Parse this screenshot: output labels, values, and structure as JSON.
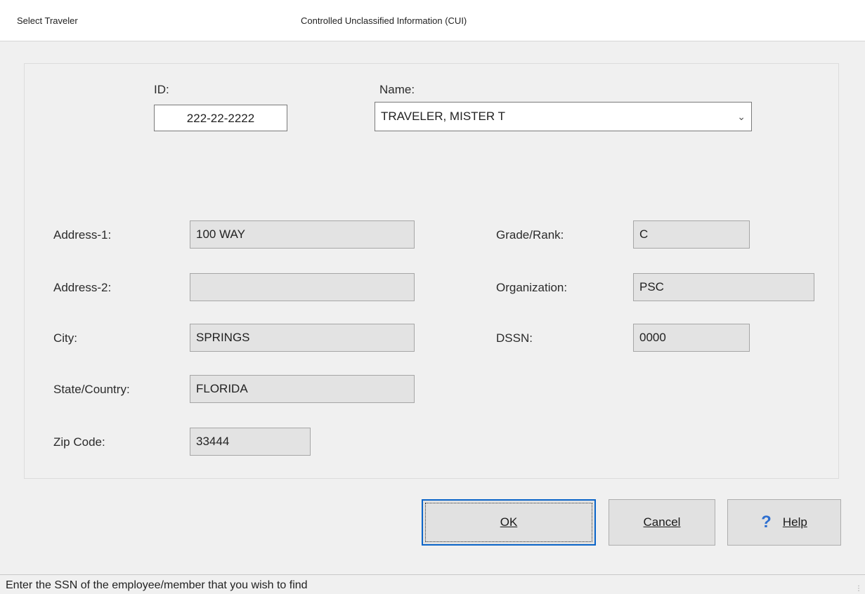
{
  "window": {
    "title_left": "Select Traveler",
    "title_center": "Controlled Unclassified Information (CUI)"
  },
  "form": {
    "id_label": "ID:",
    "id_value": "222-22-2222",
    "name_label": "Name:",
    "name_value": "TRAVELER, MISTER T",
    "address1_label": "Address-1:",
    "address1_value": "100 WAY",
    "address2_label": "Address-2:",
    "address2_value": "",
    "city_label": "City:",
    "city_value": "SPRINGS",
    "state_label": "State/Country:",
    "state_value": "FLORIDA",
    "zip_label": "Zip Code:",
    "zip_value": "33444",
    "grade_label": "Grade/Rank:",
    "grade_value": "C",
    "org_label": "Organization:",
    "org_value": "PSC",
    "dssn_label": "DSSN:",
    "dssn_value": "0000"
  },
  "buttons": {
    "ok_label": "OK",
    "cancel_label": "Cancel",
    "help_label": "Help",
    "help_icon": "?"
  },
  "status": {
    "text": "Enter the SSN of the employee/member that you wish to find"
  }
}
